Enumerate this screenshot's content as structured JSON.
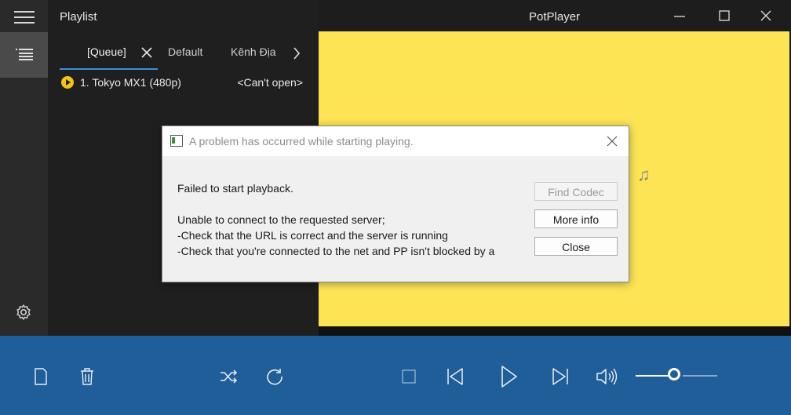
{
  "panel": {
    "title": "Playlist",
    "tabs": [
      {
        "label": "[Queue]"
      },
      {
        "label": "Default"
      },
      {
        "label": "Kênh Địa"
      }
    ],
    "items": [
      {
        "name": "1. Tokyo MX1 (480p)",
        "status": "<Can't open>"
      }
    ]
  },
  "app": {
    "title": "PotPlayer"
  },
  "dialog": {
    "title": "A problem has occurred while starting playing.",
    "message_line1": "Failed to start playback.",
    "message_line2": "Unable to connect to the requested server;",
    "message_line3": "-Check that the URL is correct and the server is running",
    "message_line4": "-Check that you're connected to the net and PP isn't blocked by a",
    "buttons": {
      "find_codec": "Find Codec",
      "more_info": "More info",
      "close": "Close"
    }
  },
  "controls": {
    "volume_level": 0.5
  },
  "colors": {
    "video_bg": "#fce455",
    "control_bar": "#1f5e98",
    "accent": "#3b8fd6",
    "item_icon": "#f3c318"
  }
}
